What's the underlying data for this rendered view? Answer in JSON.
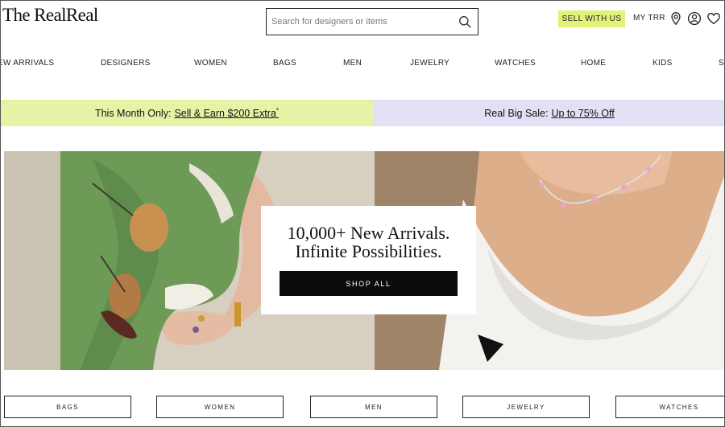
{
  "header": {
    "logo": "The RealReal",
    "search_placeholder": "Search for designers or items",
    "sell_label": "SELL WITH US",
    "my_trr_label": "MY TRR",
    "icons": [
      "search-icon",
      "location-pin-icon",
      "account-icon",
      "heart-icon"
    ]
  },
  "nav": {
    "items": [
      "EW ARRIVALS",
      "DESIGNERS",
      "WOMEN",
      "BAGS",
      "MEN",
      "JEWELRY",
      "WATCHES",
      "HOME",
      "KIDS",
      "S"
    ]
  },
  "promos": {
    "left": {
      "prefix": "This Month Only:",
      "link": "Sell & Earn $200 Extra",
      "suffix": "*",
      "color": "#e8f2a6"
    },
    "right": {
      "prefix": "Real Big Sale:",
      "link": "Up to 75% Off",
      "color": "#e2e0f5"
    }
  },
  "hero": {
    "title_line1": "10,000+ New Arrivals.",
    "title_line2": "Infinite Possibilities.",
    "cta_label": "SHOP ALL"
  },
  "categories": [
    "BAGS",
    "WOMEN",
    "MEN",
    "JEWELRY",
    "WATCHES"
  ],
  "colors": {
    "sell_button": "#e3f07a",
    "cta_background": "#0c0c0c"
  }
}
